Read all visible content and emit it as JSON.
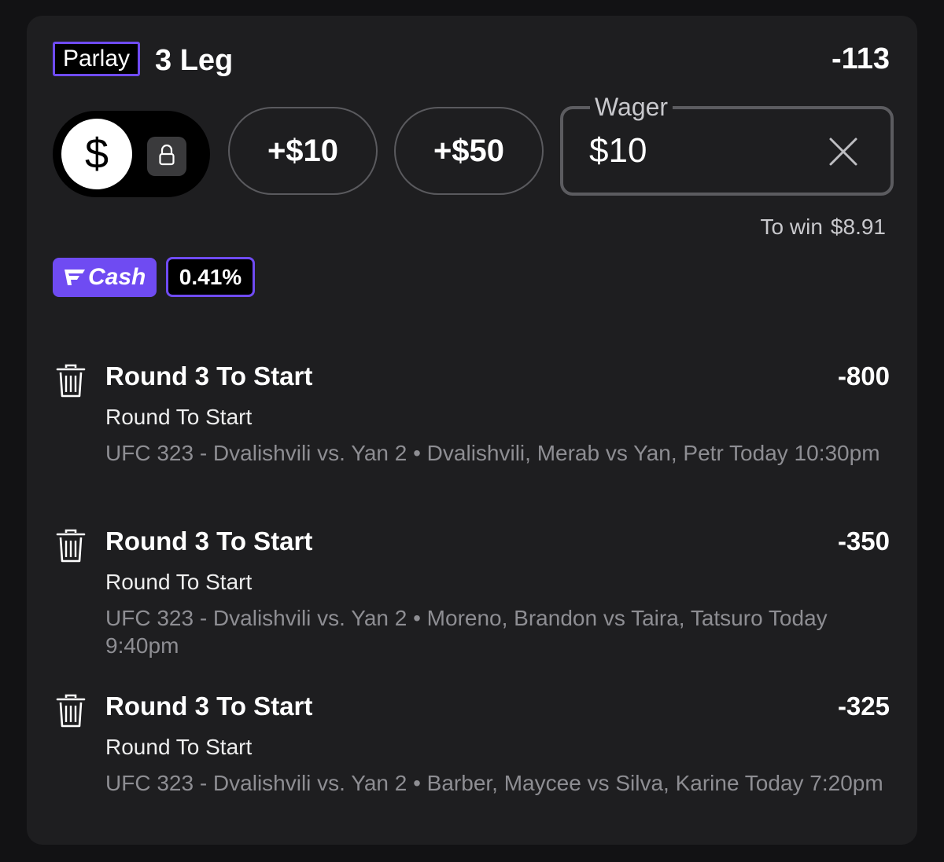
{
  "header": {
    "bet_type": "Parlay",
    "legs_label": "3 Leg",
    "total_odds": "-113"
  },
  "toggle": {
    "active_icon": "dollar-icon",
    "active_glyph": "$",
    "inactive_icon": "lock-icon"
  },
  "quick_amounts": [
    "+$10",
    "+$50"
  ],
  "wager": {
    "legend": "Wager",
    "value": "$10",
    "clear_icon": "close-icon"
  },
  "payout": {
    "label": "To win",
    "value": "$8.91"
  },
  "fcash": {
    "label": "Cash",
    "percent": "0.41%"
  },
  "colors": {
    "accent": "#6f4bf2",
    "card": "#1e1e20",
    "background": "#121214",
    "muted_text": "#8e8e93"
  },
  "legs": [
    {
      "title": "Round 3 To Start",
      "odds": "-800",
      "market": "Round To Start",
      "event": "UFC 323 - Dvalishvili vs. Yan 2 • Dvalishvili, Merab vs Yan, Petr Today 10:30pm"
    },
    {
      "title": "Round 3 To Start",
      "odds": "-350",
      "market": "Round To Start",
      "event": "UFC 323 - Dvalishvili vs. Yan 2 • Moreno, Brandon vs Taira, Tatsuro Today 9:40pm"
    },
    {
      "title": "Round 3 To Start",
      "odds": "-325",
      "market": "Round To Start",
      "event": "UFC 323 - Dvalishvili vs. Yan 2 • Barber, Maycee vs Silva, Karine Today 7:20pm"
    }
  ]
}
